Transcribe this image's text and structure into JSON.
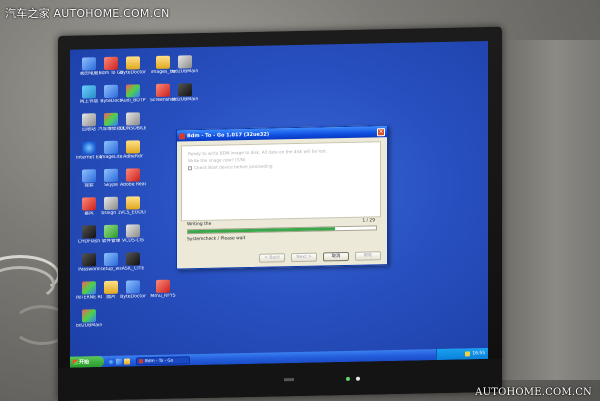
{
  "watermark": {
    "top": "汽车之家  AUTOHOME.COM.CN",
    "bottom": "AUTOHOME.COM.CN"
  },
  "desktop": {
    "icons": [
      {
        "label": "我的电脑",
        "icon": "my-computer-icon",
        "color": "blue"
      },
      {
        "label": "Bdm To Go",
        "icon": "app-icon",
        "color": "red"
      },
      {
        "label": "ByteDoctor Log",
        "icon": "folder-icon",
        "color": "folder"
      },
      {
        "label": "images_be",
        "icon": "folder-icon",
        "color": "folder"
      },
      {
        "label": "bd2UBMain",
        "icon": "document-icon",
        "color": "gray"
      },
      {
        "label": "网上邻居",
        "icon": "network-icon",
        "color": "net"
      },
      {
        "label": "ByteDoct",
        "icon": "app-icon",
        "color": "blue"
      },
      {
        "label": "Audi_BOTP",
        "icon": "app-icon",
        "color": "mixed"
      },
      {
        "label": "Screenshot 2010_07_2",
        "icon": "image-icon",
        "color": "red"
      },
      {
        "label": "bd2UBMain",
        "icon": "archive-icon",
        "color": "dark"
      },
      {
        "label": "回收站",
        "icon": "recycle-bin-icon",
        "color": "gray"
      },
      {
        "label": "汽车维修技术",
        "icon": "app-icon",
        "color": "mixed"
      },
      {
        "label": "CONSOBILE",
        "icon": "app-icon",
        "color": "gray"
      },
      {
        "label": "Internet Explorer",
        "icon": "internet-explorer-icon",
        "color": "ie"
      },
      {
        "label": "ImageLite",
        "icon": "app-icon",
        "color": "blue"
      },
      {
        "label": "AdbeRdr",
        "icon": "folder-icon",
        "color": "folder"
      },
      {
        "label": "搜索",
        "icon": "search-icon",
        "color": "blue"
      },
      {
        "label": "Skype",
        "icon": "skype-icon",
        "color": "blue"
      },
      {
        "label": "Adobe Reader 9",
        "icon": "pdf-icon",
        "color": "red"
      },
      {
        "label": "暴风",
        "icon": "media-player-icon",
        "color": "red"
      },
      {
        "label": "bssign 1",
        "icon": "app-icon",
        "color": "gray"
      },
      {
        "label": "VCS_EGOLI",
        "icon": "folder-icon",
        "color": "folder"
      },
      {
        "label": "CHDFlash",
        "icon": "app-icon",
        "color": "dark"
      },
      {
        "label": "软件管理",
        "icon": "app-icon",
        "color": "green"
      },
      {
        "label": "VCDS-CIS",
        "icon": "app-icon",
        "color": "gray"
      },
      {
        "label": "Password",
        "icon": "key-icon",
        "color": "dark"
      },
      {
        "label": "setup_ws",
        "icon": "setup-icon",
        "color": "blue"
      },
      {
        "label": "ASIL_CITE",
        "icon": "app-icon",
        "color": "dark"
      },
      {
        "label": "INTERNE ROUTE",
        "icon": "app-icon",
        "color": "mixed"
      },
      {
        "label": "图片",
        "icon": "folder-icon",
        "color": "folder"
      },
      {
        "label": "ByteDoctor",
        "icon": "app-icon",
        "color": "blue"
      },
      {
        "label": "Mmu_RFYS",
        "icon": "app-icon",
        "color": "red"
      },
      {
        "label": "bd2UBMain",
        "icon": "app-icon",
        "color": "mixed"
      }
    ]
  },
  "dialog": {
    "title": "Bdm - To - Go     1.017 (32ue32)",
    "close_label": "×",
    "lines": [
      "Ready to write BDM image to disk. All data on the disk will be lost.",
      "Write the image now? (Y/N)",
      "Check Boot device before proceeding"
    ],
    "checkbox_label": "Check Boot device before proceeding",
    "section_label": "Writing the",
    "percent": "1 / 29",
    "progress": 0.78,
    "status": "Systemcheck / Please wait",
    "buttons": [
      "< Back",
      "Next >",
      "取消",
      "帮助"
    ]
  },
  "taskbar": {
    "start_label": "开始",
    "task_label": "Bdm - To - Go",
    "clock": "16:55"
  },
  "colors": {
    "desktop": "#2850c0",
    "taskbar": "#245edc",
    "start": "#2a9a2a",
    "progress": "#3aa84a"
  }
}
